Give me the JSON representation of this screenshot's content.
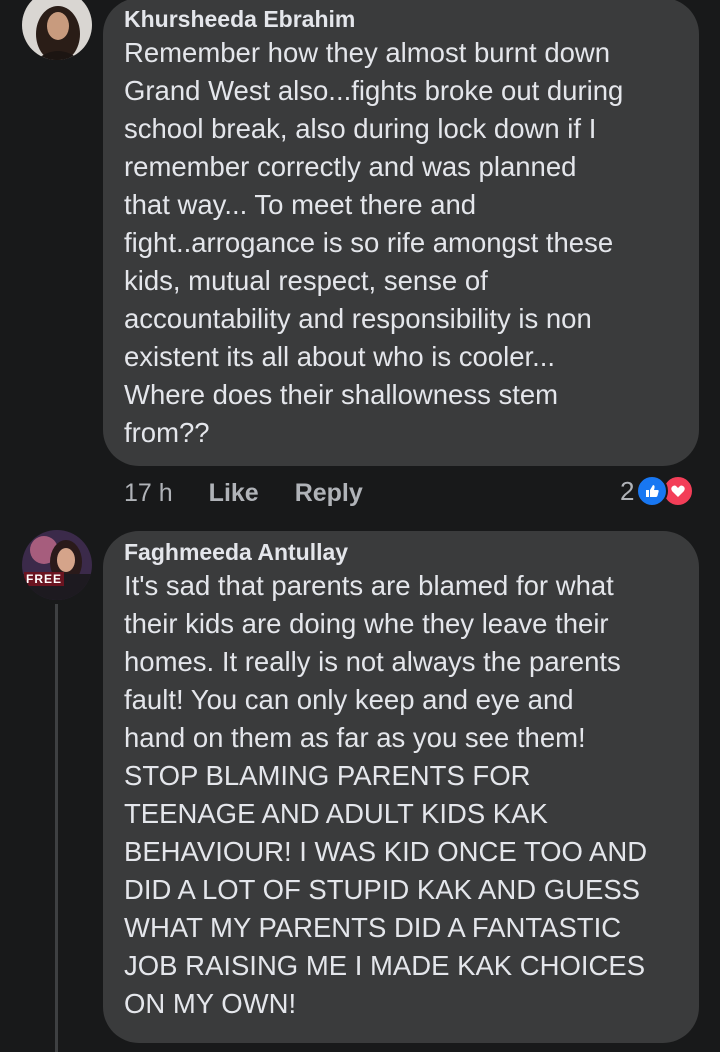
{
  "comments": [
    {
      "author": "Khursheeda Ebrahim",
      "text": "Remember how they almost burnt down\nGrand West also...fights broke out during\nschool break, also during lock down if I\nremember correctly and was planned\nthat way... To meet there and\nfight..arrogance is so rife amongst these\nkids, mutual respect, sense of\naccountability and responsibility is non\nexistent its all about who is cooler...\nWhere does their shallowness stem\nfrom??",
      "time": "17 h",
      "like_label": "Like",
      "reply_label": "Reply",
      "reaction_count": "2",
      "reaction_icons": [
        "like-icon",
        "love-icon"
      ]
    },
    {
      "author": "Faghmeeda Antullay",
      "avatar_text": "FREE",
      "text": "It's sad that parents are blamed for what\ntheir kids are doing whe they leave their\nhomes. It really is not always the parents\nfault! You can only keep and eye and\nhand on them as far as you see them!\nSTOP BLAMING PARENTS FOR\nTEENAGE AND ADULT KIDS KAK\nBEHAVIOUR! I WAS KID ONCE TOO AND\nDID A LOT OF STUPID KAK AND GUESS\nWHAT MY PARENTS DID A FANTASTIC\nJOB RAISING ME I MADE KAK CHOICES\nON MY OWN!"
    }
  ],
  "colors": {
    "background": "#18191a",
    "bubble": "#3a3b3c",
    "text": "#e4e6eb",
    "secondary": "#b0b3b8",
    "like_blue": "#1877f2",
    "love_red": "#f33e58"
  }
}
